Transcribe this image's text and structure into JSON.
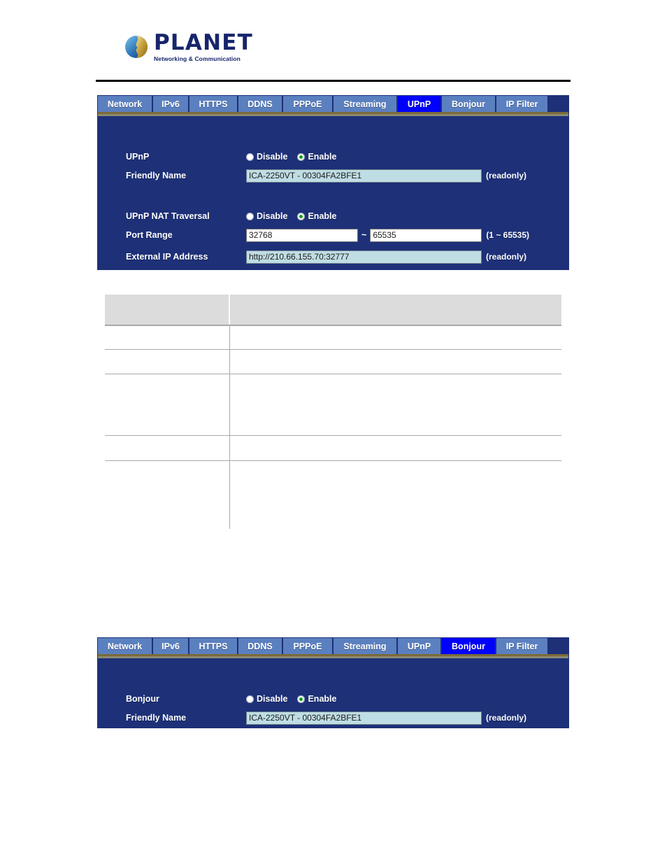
{
  "brand": {
    "name": "PLANET",
    "tagline": "Networking & Communication",
    "logo_icon": "globe-icon",
    "text_color": "#16256b"
  },
  "colors": {
    "panel_bg": "#1d3078",
    "tab_bg": "#5b80c0",
    "tab_active_bg": "#0000ff",
    "tab_text": "#ffffff",
    "readonly_field_bg": "#bfdde4",
    "radio_selected_dot": "#13a013",
    "table_header_bg": "#dcdcdc"
  },
  "tabs": [
    {
      "label": "Network",
      "active": false
    },
    {
      "label": "IPv6",
      "active": false
    },
    {
      "label": "HTTPS",
      "active": false
    },
    {
      "label": "DDNS",
      "active": false
    },
    {
      "label": "PPPoE",
      "active": false
    },
    {
      "label": "Streaming",
      "active": false
    },
    {
      "label": "UPnP",
      "active": true
    },
    {
      "label": "Bonjour",
      "active": false
    },
    {
      "label": "IP Filter",
      "active": false
    }
  ],
  "tabs_bonjour": [
    {
      "label": "Network",
      "active": false
    },
    {
      "label": "IPv6",
      "active": false
    },
    {
      "label": "HTTPS",
      "active": false
    },
    {
      "label": "DDNS",
      "active": false
    },
    {
      "label": "PPPoE",
      "active": false
    },
    {
      "label": "Streaming",
      "active": false
    },
    {
      "label": "UPnP",
      "active": false
    },
    {
      "label": "Bonjour",
      "active": true
    },
    {
      "label": "IP Filter",
      "active": false
    }
  ],
  "upnp_panel": {
    "upnp": {
      "label": "UPnP",
      "option_disable": "Disable",
      "option_enable": "Enable",
      "selected": "Enable"
    },
    "friendly_name": {
      "label": "Friendly Name",
      "value": "ICA-2250VT - 00304FA2BFE1",
      "placeholder": "",
      "note": "(readonly)",
      "readonly": true
    },
    "nat_traversal": {
      "label": "UPnP NAT Traversal",
      "option_disable": "Disable",
      "option_enable": "Enable",
      "selected": "Enable"
    },
    "port_range": {
      "label": "Port Range",
      "from_value": "32768",
      "to_value": "65535",
      "separator": "~",
      "hint": "(1 ~ 65535)"
    },
    "external_ip": {
      "label": "External IP Address",
      "value": "http://210.66.155.70:32777",
      "note": "(readonly)",
      "readonly": true
    }
  },
  "bonjour_panel": {
    "bonjour": {
      "label": "Bonjour",
      "option_disable": "Disable",
      "option_enable": "Enable",
      "selected": "Enable"
    },
    "friendly_name": {
      "label": "Friendly Name",
      "value": "ICA-2250VT - 00304FA2BFE1",
      "note": "(readonly)",
      "readonly": true
    }
  },
  "description_table": {
    "headers": [
      "",
      ""
    ],
    "rows": [
      [
        "",
        ""
      ],
      [
        "",
        ""
      ],
      [
        "",
        ""
      ],
      [
        "",
        ""
      ],
      [
        "",
        ""
      ]
    ]
  }
}
